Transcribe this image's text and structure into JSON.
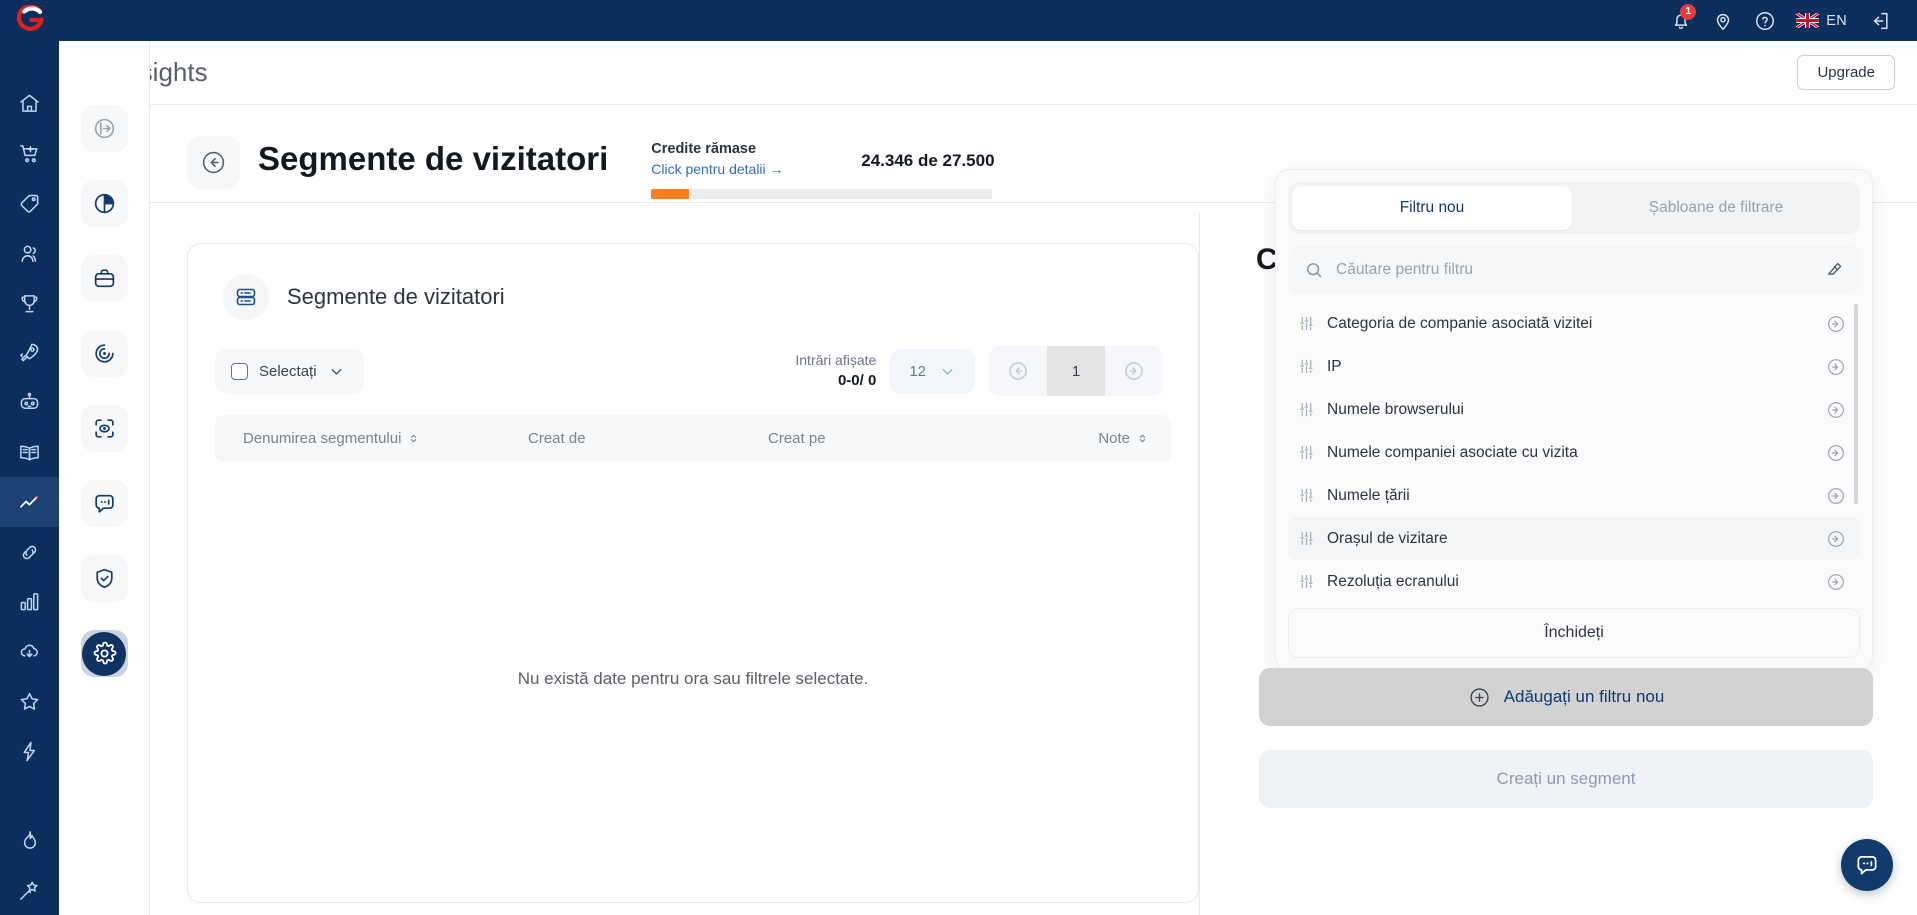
{
  "app": {
    "brand_logo": "g-logo",
    "accent_orange": "#f57f20",
    "navy": "#0b2e5c",
    "badge_red": "#e8393c"
  },
  "topbar": {
    "notifications_icon": "bell-icon",
    "notifications_count": "1",
    "location_icon": "location-pin-icon",
    "help_icon": "help-circle-icon",
    "language_flag": "uk-flag-icon",
    "language_label": "EN",
    "logout_icon": "logout-icon"
  },
  "page_header": {
    "icon": "trend-line-icon",
    "title": "Insights",
    "upgrade_label": "Upgrade"
  },
  "primary_sidebar": {
    "items": [
      {
        "name": "home",
        "icon": "home-icon",
        "active": false
      },
      {
        "name": "shop",
        "icon": "shopping-cart-icon",
        "active": false
      },
      {
        "name": "tags",
        "icon": "tag-icon",
        "active": false
      },
      {
        "name": "contacts",
        "icon": "users-icon",
        "active": false
      },
      {
        "name": "achievements",
        "icon": "trophy-icon",
        "active": false
      },
      {
        "name": "launch",
        "icon": "rocket-icon",
        "active": false
      },
      {
        "name": "bot",
        "icon": "robot-icon",
        "active": false
      },
      {
        "name": "knowledge",
        "icon": "book-icon",
        "active": false
      },
      {
        "name": "insights",
        "icon": "trend-line-icon",
        "active": true
      },
      {
        "name": "links",
        "icon": "link-icon",
        "active": false
      },
      {
        "name": "reports",
        "icon": "bar-chart-icon",
        "active": false
      },
      {
        "name": "downloads",
        "icon": "cloud-download-icon",
        "active": false
      },
      {
        "name": "favorites",
        "icon": "star-icon",
        "active": false
      },
      {
        "name": "automation",
        "icon": "lightning-icon",
        "active": false
      },
      {
        "name": "trending",
        "icon": "flame-icon",
        "active": false
      },
      {
        "name": "magic",
        "icon": "magic-wand-icon",
        "active": false
      }
    ]
  },
  "secondary_rail": {
    "items": [
      {
        "name": "collapse-panel",
        "icon": "panel-collapse-icon",
        "active": false
      },
      {
        "name": "overview",
        "icon": "pie-chart-icon",
        "active": false
      },
      {
        "name": "briefcase",
        "icon": "briefcase-icon",
        "active": false
      },
      {
        "name": "activity",
        "icon": "radar-icon",
        "active": false
      },
      {
        "name": "visitor-scan",
        "icon": "scan-eye-icon",
        "active": false
      },
      {
        "name": "messages",
        "icon": "chat-bubble-icon",
        "active": false
      },
      {
        "name": "security",
        "icon": "shield-check-icon",
        "active": false
      },
      {
        "name": "settings",
        "icon": "gear-icon",
        "active": true
      }
    ]
  },
  "main": {
    "back_icon": "arrow-left-circle-icon",
    "heading": "Segmente de vizitatori",
    "credits": {
      "title": "Credite rămase",
      "detail_link": "Click pentru detalii →",
      "amount": "24.346 de 27.500",
      "progress_percent": 11
    },
    "card": {
      "icon": "server-list-icon",
      "title": "Segmente de vizitatori",
      "select_label": "Selectați",
      "select_chevron": "chevron-down-icon",
      "entries_label": "Intrări afișate",
      "entries_count": "0-0/ 0",
      "per_page_value": "12",
      "per_page_chevron": "chevron-down-icon",
      "prev_icon": "arrow-left-circle-icon",
      "page_current": "1",
      "next_icon": "arrow-right-circle-icon",
      "columns": [
        {
          "label": "Denumirea segmentului",
          "sortable": true
        },
        {
          "label": "Creat de",
          "sortable": false
        },
        {
          "label": "Creat pe",
          "sortable": false
        },
        {
          "label": "Note",
          "sortable": true
        }
      ],
      "rows": [],
      "empty_message": "Nu există date pentru ora sau filtrele selectate."
    },
    "obscured_heading": "C"
  },
  "filter_panel": {
    "tabs": [
      {
        "label": "Filtru nou",
        "active": true
      },
      {
        "label": "Șabloane de filtrare",
        "active": false
      }
    ],
    "search_icon": "search-icon",
    "search_placeholder": "Căutare pentru filtru",
    "search_value": "",
    "clear_icon": "eraser-icon",
    "items": [
      {
        "label": "Categoria de companie asociată vizitei",
        "icon": "sliders-icon",
        "go_icon": "arrow-right-circle-icon",
        "hovered": false
      },
      {
        "label": "IP",
        "icon": "sliders-icon",
        "go_icon": "arrow-right-circle-icon",
        "hovered": false
      },
      {
        "label": "Numele browserului",
        "icon": "sliders-icon",
        "go_icon": "arrow-right-circle-icon",
        "hovered": false
      },
      {
        "label": "Numele companiei asociate cu vizita",
        "icon": "sliders-icon",
        "go_icon": "arrow-right-circle-icon",
        "hovered": false
      },
      {
        "label": "Numele țării",
        "icon": "sliders-icon",
        "go_icon": "arrow-right-circle-icon",
        "hovered": false
      },
      {
        "label": "Orașul de vizitare",
        "icon": "sliders-icon",
        "go_icon": "arrow-right-circle-icon",
        "hovered": true
      },
      {
        "label": "Rezoluția ecranului",
        "icon": "sliders-icon",
        "go_icon": "arrow-right-circle-icon",
        "hovered": false
      }
    ],
    "close_label": "Închideți",
    "add_filter_label": "Adăugați un filtru nou",
    "add_filter_icon": "plus-circle-icon",
    "create_segment_label": "Creați un segment"
  },
  "chat_fab": {
    "icon": "chat-bubble-icon"
  }
}
